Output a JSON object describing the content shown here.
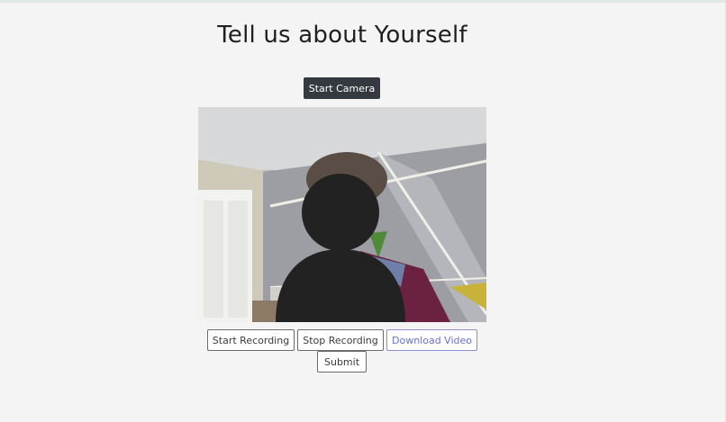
{
  "page": {
    "title": "Tell us about Yourself"
  },
  "camera": {
    "start_label": "Start Camera"
  },
  "controls": {
    "start_recording_label": "Start Recording",
    "stop_recording_label": "Stop Recording",
    "download_label": "Download Video",
    "submit_label": "Submit"
  },
  "colors": {
    "dark_button": "#343a40",
    "download_accent": "#6b72c9"
  }
}
